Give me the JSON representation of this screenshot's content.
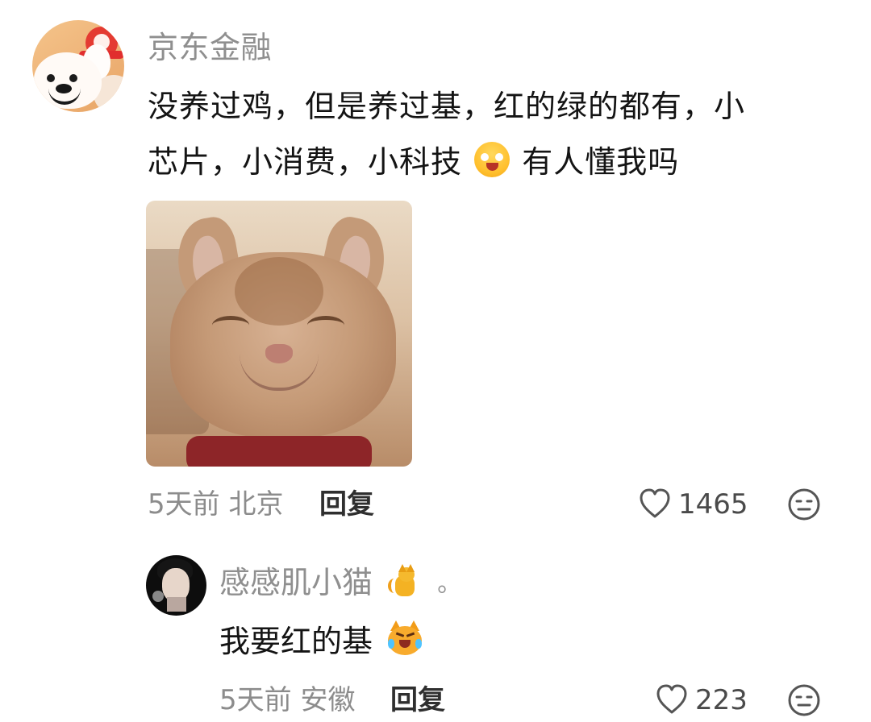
{
  "top_comment": {
    "username": "京东金融",
    "text_line_1": "没养过鸡，但是养过基，红的绿的都有，小",
    "text_line_2_before_emoji": "芯片，小消费，小科技",
    "text_line_2_after_emoji": "有人懂我吗",
    "meta": "5天前 北京",
    "reply_label": "回复",
    "like_count": "1465"
  },
  "reply_comment": {
    "username": "感感肌小猫",
    "username_suffix": "。",
    "text": "我要红的基",
    "meta": "5天前 安徽",
    "reply_label": "回复",
    "like_count": "223"
  },
  "icons": {
    "like": "heart-icon",
    "reaction": "neutral-face-icon",
    "emoji": "smiling-bag-emoji",
    "cat": "cat-emoji",
    "sad_cat": "crying-cat-emoji"
  },
  "colors": {
    "username": "#8f8f8f",
    "text": "#141414",
    "meta": "#8c8c8c"
  }
}
